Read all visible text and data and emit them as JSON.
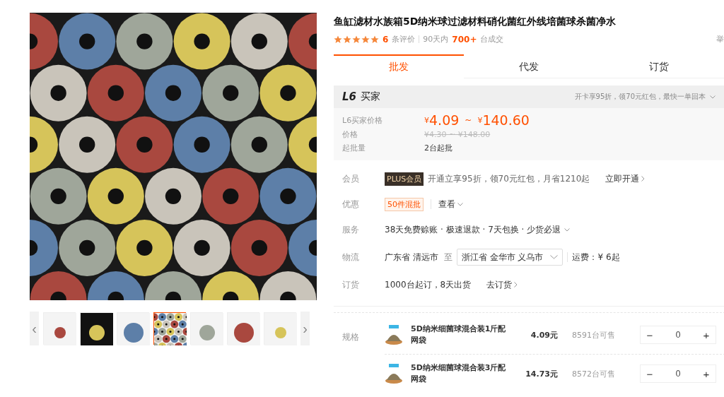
{
  "gallery": {
    "thumbnails": [
      {
        "selected": false
      },
      {
        "selected": false
      },
      {
        "selected": false
      },
      {
        "selected": true
      },
      {
        "selected": false
      },
      {
        "selected": false
      },
      {
        "selected": false
      }
    ],
    "prev": "‹",
    "next": "›"
  },
  "product": {
    "title": "鱼缸滤材水族箱5D纳米球过滤材料硝化菌红外线培菌球杀菌净水",
    "stars": 5,
    "review_count": "6",
    "review_label": "条评价",
    "sales_prefix": "90天内",
    "sales_count": "700+",
    "sales_suffix": "台成交",
    "report": "举"
  },
  "tabs": [
    {
      "label": "批发",
      "selected": true
    },
    {
      "label": "代发",
      "selected": false
    },
    {
      "label": "订货",
      "selected": false
    }
  ],
  "price_box": {
    "level_badge": "L6",
    "level_name": "买家",
    "promo": "开卡享95折，领70元红包，最快一单回本",
    "rows": [
      {
        "kind": "price",
        "label": "L6买家价格",
        "low": "4.09",
        "high": "140.60",
        "currency": "¥",
        "sep": "~"
      },
      {
        "kind": "old",
        "label": "价格",
        "value": "¥4.30 ~ ¥148.00"
      },
      {
        "kind": "plain",
        "label": "起批量",
        "value": "2台起批"
      }
    ]
  },
  "details": {
    "member": {
      "label": "会员",
      "badge": "PLUS会员",
      "text": "开通立享95折，领70元红包，月省1210起",
      "link": "立即开通"
    },
    "discount": {
      "label": "优惠",
      "tag": "50件混批",
      "link": "查看"
    },
    "service": {
      "label": "服务",
      "text": "38天免费赊账 · 极速退款 · 7天包换 · 少货必退"
    },
    "logistics": {
      "label": "物流",
      "from": "广东省 清远市",
      "to_word": "至",
      "destination": "浙江省 金华市 义乌市",
      "fee": "运费：¥ 6起"
    },
    "order": {
      "label": "订货",
      "text": "1000台起订，8天出货",
      "link": "去订货"
    }
  },
  "specs": {
    "label": "规格",
    "items": [
      {
        "name": "5D纳米细菌球混合装1斤配网袋",
        "price": "4.09元",
        "stock": "8591台可售",
        "minus": "−",
        "qty": "0",
        "plus": "+"
      },
      {
        "name": "5D纳米细菌球混合装3斤配网袋",
        "price": "14.73元",
        "stock": "8572台可售",
        "minus": "−",
        "qty": "0",
        "plus": "+"
      }
    ]
  }
}
